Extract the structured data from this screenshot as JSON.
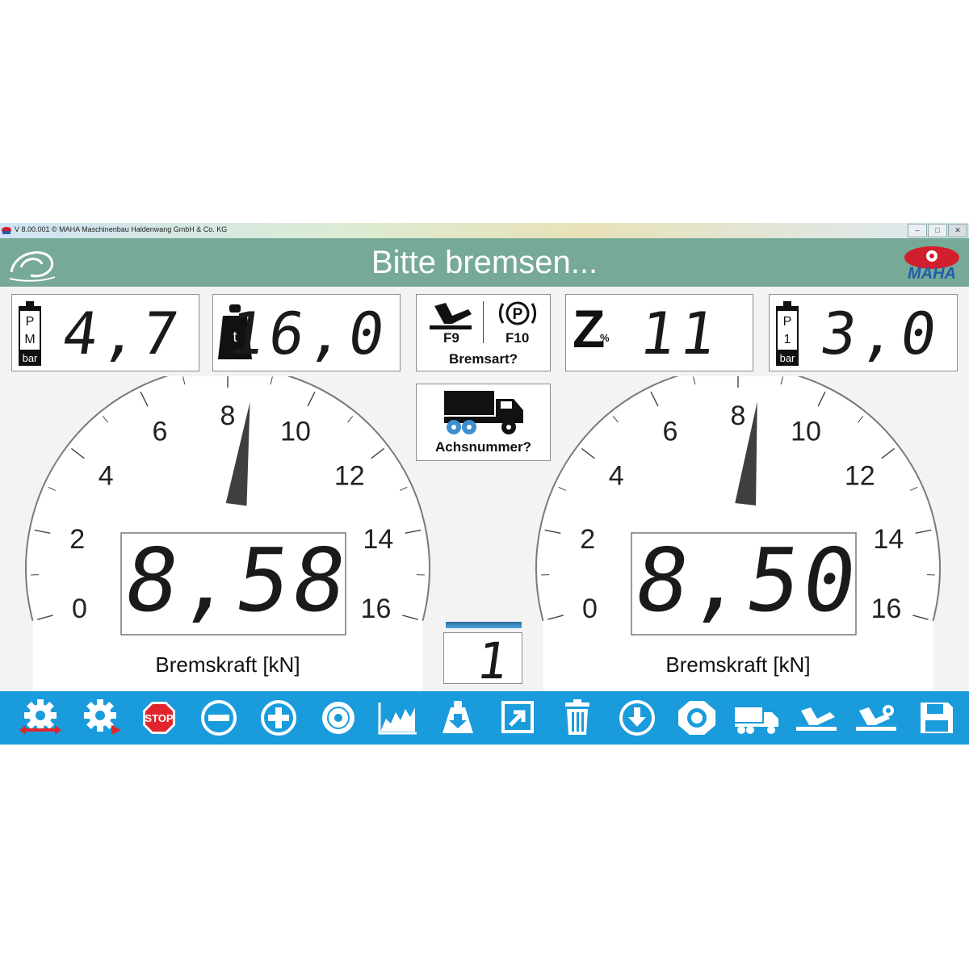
{
  "window": {
    "title": "V 8.00.001   © MAHA Maschinenbau Haldenwang GmbH & Co. KG",
    "controls": [
      "minimize",
      "maximize",
      "close"
    ]
  },
  "header": {
    "title": "Bitte bremsen...",
    "logo_text": "MAHA",
    "accent": "#77a998",
    "logo_color": "#d11f2e",
    "logo_text_color": "#1f5fa8"
  },
  "readouts": {
    "pm": {
      "icon": "pressure-gauge-icon",
      "label_top": "P",
      "label_mid": "M",
      "unit": "bar",
      "value": "4,7"
    },
    "weight": {
      "icon": "weight-icon",
      "label": "t",
      "value": "16,0"
    },
    "brake_type": {
      "f9": "F9",
      "f10": "F10",
      "parking_symbol": "P",
      "label": "Bremsart?"
    },
    "z": {
      "symbol": "Z",
      "sub": "%",
      "value": "11"
    },
    "p1": {
      "icon": "pressure-gauge-icon",
      "label_top": "P",
      "label_mid": "1",
      "unit": "bar",
      "value": "3,0"
    }
  },
  "axle": {
    "icon": "truck-icon",
    "label": "Achsnummer?",
    "value": "1"
  },
  "gauges": [
    {
      "name": "left",
      "ticks": [
        "0",
        "2",
        "4",
        "6",
        "8",
        "10",
        "12",
        "14",
        "16"
      ],
      "max": 16,
      "needle_value": 8.58,
      "value": "8,58",
      "label": "Bremskraft [kN]"
    },
    {
      "name": "right",
      "ticks": [
        "0",
        "2",
        "4",
        "6",
        "8",
        "10",
        "12",
        "14",
        "16"
      ],
      "max": 16,
      "needle_value": 8.5,
      "value": "8,50",
      "label": "Bremskraft [kN]"
    }
  ],
  "toolbar": {
    "color": "#1a9bdc",
    "stop_label": "STOP",
    "items": [
      "settings-prev-icon",
      "settings-next-icon",
      "stop-icon",
      "minus-icon",
      "plus-icon",
      "disc-icon",
      "chart-icon",
      "weight-down-icon",
      "export-icon",
      "trash-icon",
      "download-icon",
      "tire-icon",
      "truck-icon",
      "brake-pedal-icon",
      "brake-pedal-settings-icon",
      "save-icon"
    ]
  }
}
